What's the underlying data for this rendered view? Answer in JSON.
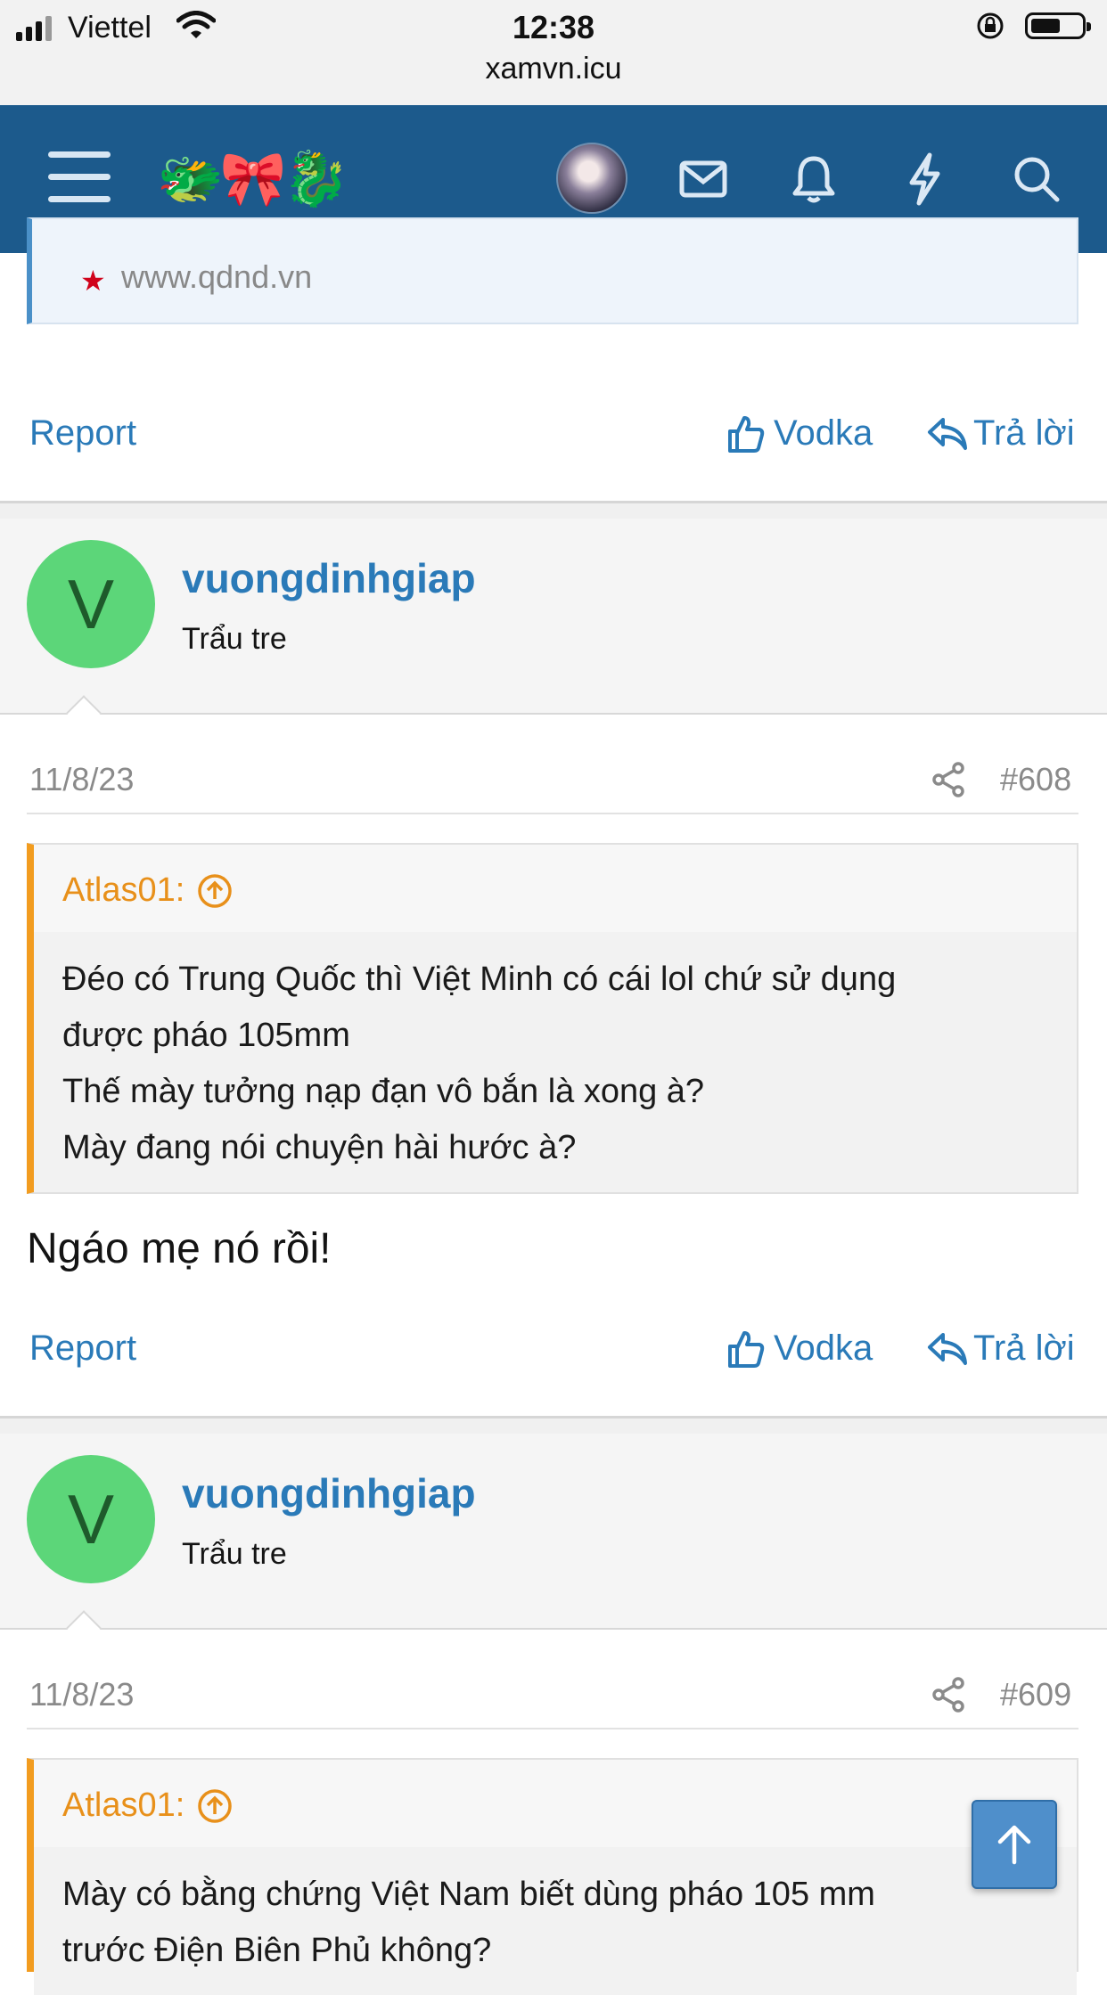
{
  "status_bar": {
    "carrier": "Viettel",
    "time": "12:38",
    "url": "xamvn.icu"
  },
  "header": {
    "logo": "🐲🎀🐉"
  },
  "previous_post": {
    "quote_source": "www.qdnd.vn",
    "actions": {
      "report": "Report",
      "like": "Vodka",
      "reply": "Trả lời"
    }
  },
  "posts": [
    {
      "avatar_letter": "V",
      "username": "vuongdinhgiap",
      "user_title": "Trẩu tre",
      "date": "11/8/23",
      "number": "#608",
      "quote": {
        "author": "Atlas01:",
        "lines": [
          "Đéo có Trung Quốc thì Việt Minh có cái lol chứ sử dụng",
          "được pháo 105mm",
          "Thế mày tưởng nạp đạn vô bắn là xong à?",
          "Mày đang nói chuyện hài hước à?"
        ]
      },
      "text": "Ngáo mẹ nó rồi!",
      "actions": {
        "report": "Report",
        "like": "Vodka",
        "reply": "Trả lời"
      }
    },
    {
      "avatar_letter": "V",
      "username": "vuongdinhgiap",
      "user_title": "Trẩu tre",
      "date": "11/8/23",
      "number": "#609",
      "quote": {
        "author": "Atlas01:",
        "lines": [
          "Mày có bằng chứng Việt Nam biết dùng pháo 105 mm",
          "trước Điện Biên Phủ không?"
        ]
      }
    }
  ],
  "colors": {
    "navbar": "#1c5a8c",
    "link": "#2a7ab8",
    "quote_accent": "#f29c1f",
    "avatar_bg": "#5cd679"
  }
}
